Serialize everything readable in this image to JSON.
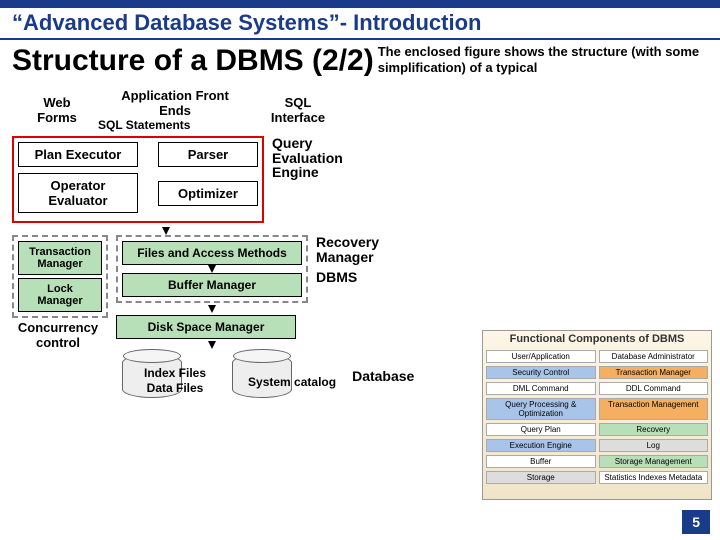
{
  "header": {
    "course_title": "“Advanced Database Systems”- Introduction",
    "slide_title": "Structure of a DBMS (2/2)",
    "description": "The enclosed figure shows the structure (with some simplification) of a typical"
  },
  "inputs": {
    "web_forms": "Web Forms",
    "app_front_ends": "Application Front Ends",
    "sql_interface": "SQL Interface",
    "sql_statements": "SQL Statements"
  },
  "query_engine": {
    "plan_executor": "Plan Executor",
    "parser": "Parser",
    "operator_evaluator": "Operator Evaluator",
    "optimizer": "Optimizer",
    "label": "Query Evaluation Engine"
  },
  "txn": {
    "txn_manager": "Transaction Manager",
    "lock_manager": "Lock Manager",
    "label": "Concurrency control"
  },
  "storage": {
    "files_access": "Files and Access Methods",
    "buffer_manager": "Buffer Manager",
    "disk_space_manager": "Disk Space Manager",
    "recovery_label": "Recovery Manager",
    "dbms_label": "DBMS"
  },
  "cylinders": {
    "index_files": "Index Files",
    "data_files": "Data Files",
    "system_catalog": "System catalog",
    "database_label": "Database"
  },
  "side_image": {
    "title": "Functional Components of DBMS",
    "row1a": "User/Application",
    "row1b": "Database Administrator",
    "row2a": "Security Control",
    "row2b": "Transaction Manager",
    "row3a": "DML Command",
    "row3b": "DDL Command",
    "row4a": "Query Processing & Optimization",
    "row4b": "Transaction Management",
    "row5a": "Query Plan",
    "row5b": "Recovery",
    "row6a": "Execution Engine",
    "row6b": "Log",
    "row7a": "Buffer",
    "row7b": "Storage Management",
    "row8a": "Storage",
    "row8b": "Statistics Indexes Metadata"
  },
  "page_number": "5"
}
